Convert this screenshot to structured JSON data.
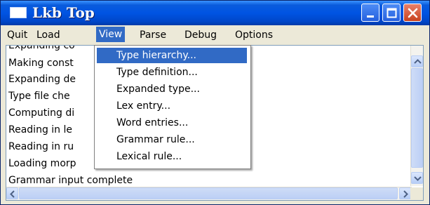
{
  "window": {
    "title": "Lkb Top"
  },
  "menubar": {
    "items": [
      "Quit",
      "Load",
      "View",
      "Parse",
      "Debug",
      "Options"
    ],
    "active": "View"
  },
  "log": {
    "lines": [
      "Expanding co",
      "Making const",
      "Expanding de",
      "Type file che",
      "Computing di",
      "Reading in le",
      "Reading in ru",
      "Loading morp",
      "Grammar input complete"
    ]
  },
  "view_menu": {
    "items": [
      "Type hierarchy...",
      "Type definition...",
      "Expanded type...",
      "Lex entry...",
      "Word entries...",
      "Grammar rule...",
      "Lexical rule..."
    ],
    "selected": "Type hierarchy..."
  },
  "icons": [
    "minimize-icon",
    "maximize-icon",
    "close-icon",
    "scroll-up-icon",
    "scroll-down-icon",
    "scroll-left-icon",
    "scroll-right-icon"
  ],
  "colors": {
    "titlebar": "#0054e3",
    "selection": "#316ac5",
    "menubar": "#ece9d8"
  }
}
